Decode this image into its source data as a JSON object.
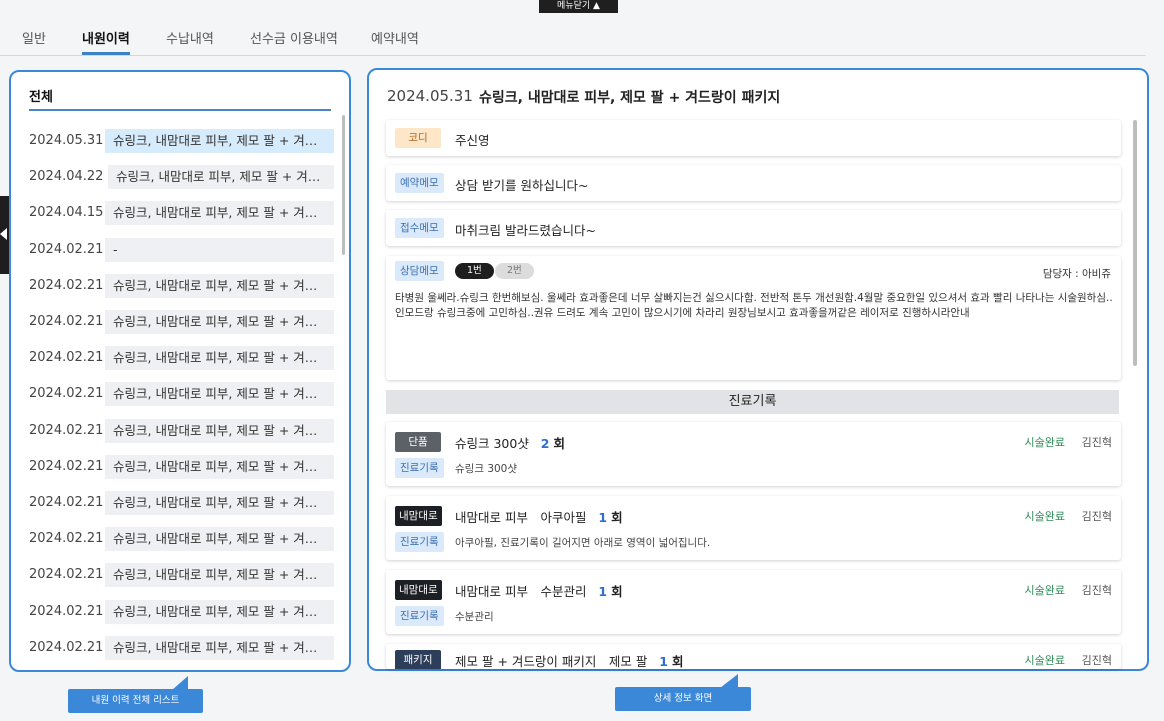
{
  "top": {
    "menu_close": "메뉴닫기 ▲"
  },
  "tabs": [
    {
      "label": "일반"
    },
    {
      "label": "내원이력"
    },
    {
      "label": "수납내역"
    },
    {
      "label": "선수금 이용내역"
    },
    {
      "label": "예약내역"
    }
  ],
  "list": {
    "title": "전체",
    "rows": [
      {
        "date": "2024.05.31",
        "title": "슈링크, 내맘대로 피부, 제모 팔 + 겨드랑...",
        "selected": true
      },
      {
        "date": "2024.04.22",
        "title": "슈링크, 내맘대로 피부, 제모 팔 + 겨드랑..."
      },
      {
        "date": "2024.04.15",
        "title": "슈링크, 내맘대로 피부, 제모 팔 + 겨드랑..."
      },
      {
        "date": "2024.02.21",
        "title": "-"
      },
      {
        "date": "2024.02.21",
        "title": "슈링크, 내맘대로 피부, 제모 팔 + 겨드랑..."
      },
      {
        "date": "2024.02.21",
        "title": "슈링크, 내맘대로 피부, 제모 팔 + 겨드랑..."
      },
      {
        "date": "2024.02.21",
        "title": "슈링크, 내맘대로 피부, 제모 팔 + 겨드랑..."
      },
      {
        "date": "2024.02.21",
        "title": "슈링크, 내맘대로 피부, 제모 팔 + 겨드랑..."
      },
      {
        "date": "2024.02.21",
        "title": "슈링크, 내맘대로 피부, 제모 팔 + 겨드랑..."
      },
      {
        "date": "2024.02.21",
        "title": "슈링크, 내맘대로 피부, 제모 팔 + 겨드랑..."
      },
      {
        "date": "2024.02.21",
        "title": "슈링크, 내맘대로 피부, 제모 팔 + 겨드랑..."
      },
      {
        "date": "2024.02.21",
        "title": "슈링크, 내맘대로 피부, 제모 팔 + 겨드랑..."
      },
      {
        "date": "2024.02.21",
        "title": "슈링크, 내맘대로 피부, 제모 팔 + 겨드랑..."
      },
      {
        "date": "2024.02.21",
        "title": "슈링크, 내맘대로 피부, 제모 팔 + 겨드랑..."
      },
      {
        "date": "2024.02.21",
        "title": "슈링크, 내맘대로 피부, 제모 팔 + 겨드랑..."
      }
    ]
  },
  "detail": {
    "date": "2024.05.31",
    "title": "슈링크, 내맘대로 피부, 제모 팔 + 겨드랑이 패키지",
    "codi": {
      "label": "코디",
      "value": "주신영"
    },
    "reserve_memo": {
      "label": "예약메모",
      "value": "상담 받기를 원하십니다~"
    },
    "reception_memo": {
      "label": "접수메모",
      "value": "마취크림 발라드렸습니다~"
    },
    "consult": {
      "label": "상담메모",
      "pill_active": "1번",
      "pill_inactive": "2번",
      "owner": "담당자 : 아비쥬",
      "text": "타병원 울쎄라.슈링크 한번해보심. 울쎄라 효과좋은데 너무 살빠지는건 싫으시다함. 전반적 톤두 개선원함.4월말 중요한일 있으셔서 효과 빨리 나타나는 시술원하심.. 인모드랑 슈링크중에 고민하심..권유 드려도 계속 고민이 많으시기에 차라리 원장님보시고 효과좋을꺼같은 레이저로 진행하시라안내"
    },
    "records_header": "진료기록",
    "records": [
      {
        "badge": "단품",
        "name": "슈링크 300샷",
        "count_num": "2",
        "count_unit": "회",
        "status": "시술완료",
        "staff": "김진혁",
        "label": "진료기록",
        "note": "슈링크 300샷"
      },
      {
        "badge": "내맘대로",
        "name": "내맘대로 피부　아쿠아필",
        "count_num": "1",
        "count_unit": "회",
        "status": "시술완료",
        "staff": "김진혁",
        "label": "진료기록",
        "note": "아쿠아필, 진료기록이 길어지면 아래로 영역이 넓어집니다."
      },
      {
        "badge": "내맘대로",
        "name": "내맘대로 피부　수분관리",
        "count_num": "1",
        "count_unit": "회",
        "status": "시술완료",
        "staff": "김진혁",
        "label": "진료기록",
        "note": "수분관리"
      },
      {
        "badge": "패키지",
        "name": "제모 팔 + 겨드랑이 패키지　제모 팔",
        "count_num": "1",
        "count_unit": "회",
        "status": "시술완료",
        "staff": "김진혁"
      }
    ]
  },
  "callouts": {
    "list": "내원 이력 전체 리스트",
    "detail": "상세 정보 화면"
  },
  "colors": {
    "accent": "#3b88d8",
    "status_done": "#2e8b57"
  }
}
